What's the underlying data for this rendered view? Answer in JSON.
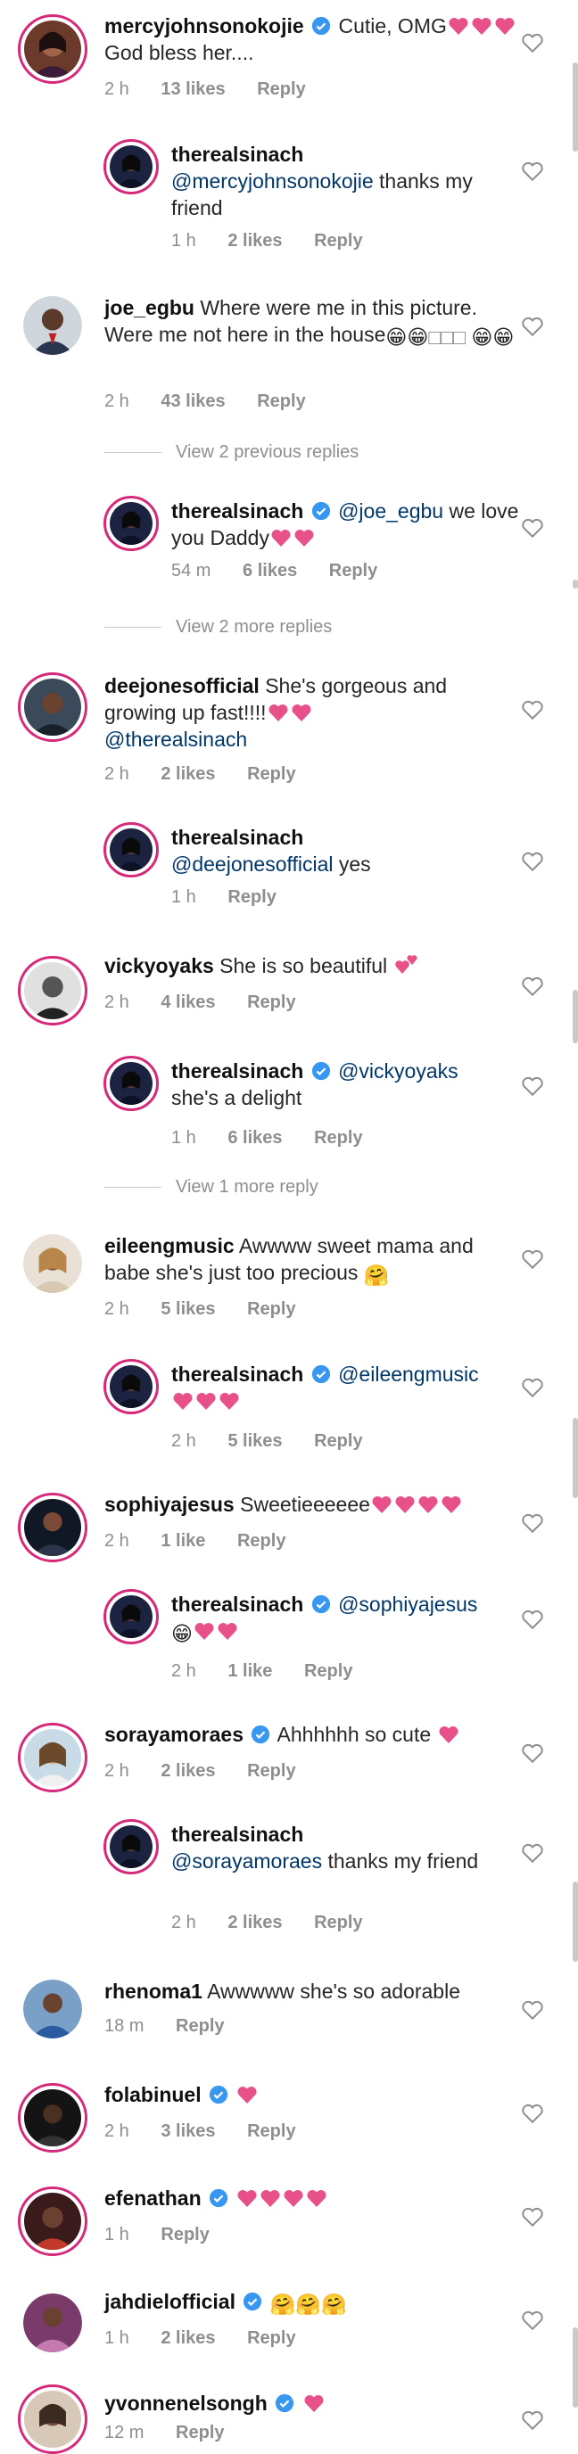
{
  "colors": {
    "accent_link": "#00376b",
    "meta": "#8e8e8e",
    "heart": "#e8508a",
    "verified": "#3897f0"
  },
  "actions": {
    "reply": "Reply"
  },
  "threads": [
    {
      "id": "c1",
      "user": "mercyjohnsonokojie",
      "verified": true,
      "text_pre": "Cutie, OMG",
      "text_post": "God bless her....",
      "time": "2 h",
      "likes": "13 likes"
    },
    {
      "id": "r1",
      "user": "therealsinach",
      "verified": false,
      "mention": "@mercyjohnsonokojie",
      "text_post": "thanks my friend",
      "time": "1 h",
      "likes": "2 likes"
    },
    {
      "id": "c2",
      "user": "joe_egbu",
      "verified": false,
      "text_pre": "Where were me in this picture. Were me not here in the house",
      "time": "2 h",
      "likes": "43 likes"
    },
    {
      "id": "v1",
      "label": "View 2 previous replies"
    },
    {
      "id": "r2",
      "user": "therealsinach",
      "verified": true,
      "mention": "@joe_egbu",
      "text_post": "we love you Daddy",
      "time": "54 m",
      "likes": "6 likes"
    },
    {
      "id": "v2",
      "label": "View 2 more replies"
    },
    {
      "id": "c3",
      "user": "deejonesofficial",
      "verified": false,
      "text_pre": "She's gorgeous and growing up fast!!!!",
      "mention": "@therealsinach",
      "time": "2 h",
      "likes": "2 likes"
    },
    {
      "id": "r3",
      "user": "therealsinach",
      "verified": false,
      "mention": "@deejonesofficial",
      "text_post": "yes",
      "time": "1 h",
      "likes": ""
    },
    {
      "id": "c4",
      "user": "vickyoyaks",
      "verified": false,
      "text_pre": "She is so beautiful",
      "time": "2 h",
      "likes": "4 likes"
    },
    {
      "id": "r4",
      "user": "therealsinach",
      "verified": true,
      "mention": "@vickyoyaks",
      "text_post": "she's a delight",
      "time": "1 h",
      "likes": "6 likes"
    },
    {
      "id": "v3",
      "label": "View 1 more reply"
    },
    {
      "id": "c5",
      "user": "eileengmusic",
      "verified": false,
      "text_pre": "Awwww sweet mama and babe she's just too precious",
      "time": "2 h",
      "likes": "5 likes"
    },
    {
      "id": "r5",
      "user": "therealsinach",
      "verified": true,
      "mention": "@eileengmusic",
      "time": "2 h",
      "likes": "5 likes"
    },
    {
      "id": "c6",
      "user": "sophiyajesus",
      "verified": false,
      "text_pre": "Sweetieeeeee",
      "time": "2 h",
      "likes": "1 like"
    },
    {
      "id": "r6",
      "user": "therealsinach",
      "verified": true,
      "mention": "@sophiyajesus",
      "time": "2 h",
      "likes": "1 like"
    },
    {
      "id": "c7",
      "user": "sorayamoraes",
      "verified": true,
      "text_pre": "Ahhhhhh so cute",
      "time": "2 h",
      "likes": "2 likes"
    },
    {
      "id": "r7",
      "user": "therealsinach",
      "verified": false,
      "mention": "@sorayamoraes",
      "text_post": "thanks my friend",
      "time": "2 h",
      "likes": "2 likes"
    },
    {
      "id": "c8",
      "user": "rhenoma1",
      "verified": false,
      "text_pre": "Awwwww she's so adorable",
      "time": "18 m",
      "likes": ""
    },
    {
      "id": "c9",
      "user": "folabinuel",
      "verified": true,
      "time": "2 h",
      "likes": "3 likes"
    },
    {
      "id": "c10",
      "user": "efenathan",
      "verified": true,
      "time": "1 h",
      "likes": ""
    },
    {
      "id": "c11",
      "user": "jahdielofficial",
      "verified": true,
      "time": "1 h",
      "likes": "2 likes"
    },
    {
      "id": "c12",
      "user": "yvonnenelsongh",
      "verified": true,
      "time": "12 m",
      "likes": ""
    }
  ]
}
